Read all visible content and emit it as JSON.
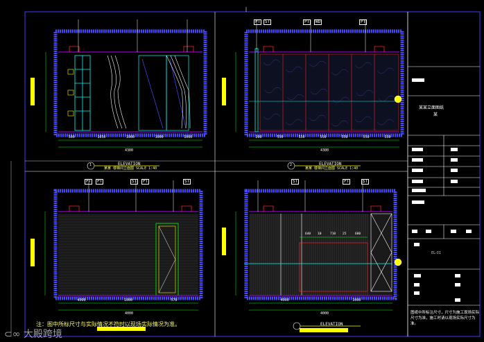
{
  "panels": [
    {
      "id": "top-left",
      "elevation_label": "ELEVATION",
      "sub_label": "某某 楼梯间立面图   SCALE 1:40",
      "marker_number": "1",
      "top_dims": [
        "500",
        "1050",
        "1000",
        "1000",
        "1000"
      ],
      "total_dim": "4300"
    },
    {
      "id": "top-right",
      "elevation_label": "ELEVATION",
      "sub_label": "某某 楼梯间立面图   SCALE 1:40",
      "marker_number": "2",
      "top_dims": [
        "200",
        "550",
        "550",
        "550",
        "550",
        "550",
        "550"
      ],
      "total_dim": "4300"
    },
    {
      "id": "bottom-left",
      "elevation_label": "",
      "sub_label": "",
      "top_dims": [
        "4000",
        "1000",
        "570"
      ],
      "total_dim": "4000"
    },
    {
      "id": "bottom-right",
      "elevation_label": "ELEVATION",
      "sub_label": "",
      "top_dims": [
        "4000",
        "1000"
      ],
      "inner_dims": [
        "640",
        "10",
        "710",
        "25",
        "680"
      ],
      "total_dim": "4000"
    }
  ],
  "tags": [
    "PT",
    "PT",
    "ST",
    "PT",
    "ST",
    "PT",
    "ST",
    "PT",
    "WD",
    "PT",
    "ST",
    "PT",
    "ST"
  ],
  "title_block": {
    "project_title": "某某立面图纸",
    "project_sub": "某",
    "sheet_no": "EL-01",
    "note": "图纸中所标注尺寸，尺寸为施工现场实际尺寸为准，施工时请以现场实际尺寸为准。"
  },
  "footer_note": "注：图中所标尺寸与实际情况不符时以现场实际情况为准。",
  "watermark": "大殿跨境",
  "colors": {
    "frame": "#3b3bff",
    "title_block": "#ffffff",
    "wall": "#4848ff",
    "purple": "#b400ff",
    "cyan": "#00ffff",
    "yellow": "#ffff00",
    "green": "#00ff00",
    "magenta": "#ff00ff",
    "red": "#ff2020"
  }
}
